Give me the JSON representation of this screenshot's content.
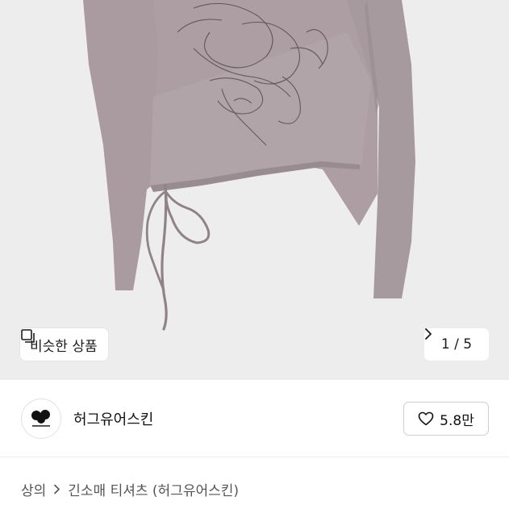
{
  "gallery": {
    "similar_label": "비슷한 상품",
    "counter": "1 / 5",
    "icon": "similar-items-icon",
    "next_icon": "chevron-right-icon"
  },
  "shop": {
    "name": "허그유어스킨",
    "logo": "hug-your-skin-logo",
    "likes": "5.8만",
    "like_icon": "heart-outline-icon"
  },
  "breadcrumb": {
    "items": [
      "상의",
      "긴소매 티셔츠 (허그유어스킨)"
    ],
    "separator_icon": "chevron-right-icon"
  },
  "colors": {
    "garment": "#ad9fa3",
    "hero_bg": "#ededee",
    "text": "#111111",
    "muted": "#555555"
  }
}
